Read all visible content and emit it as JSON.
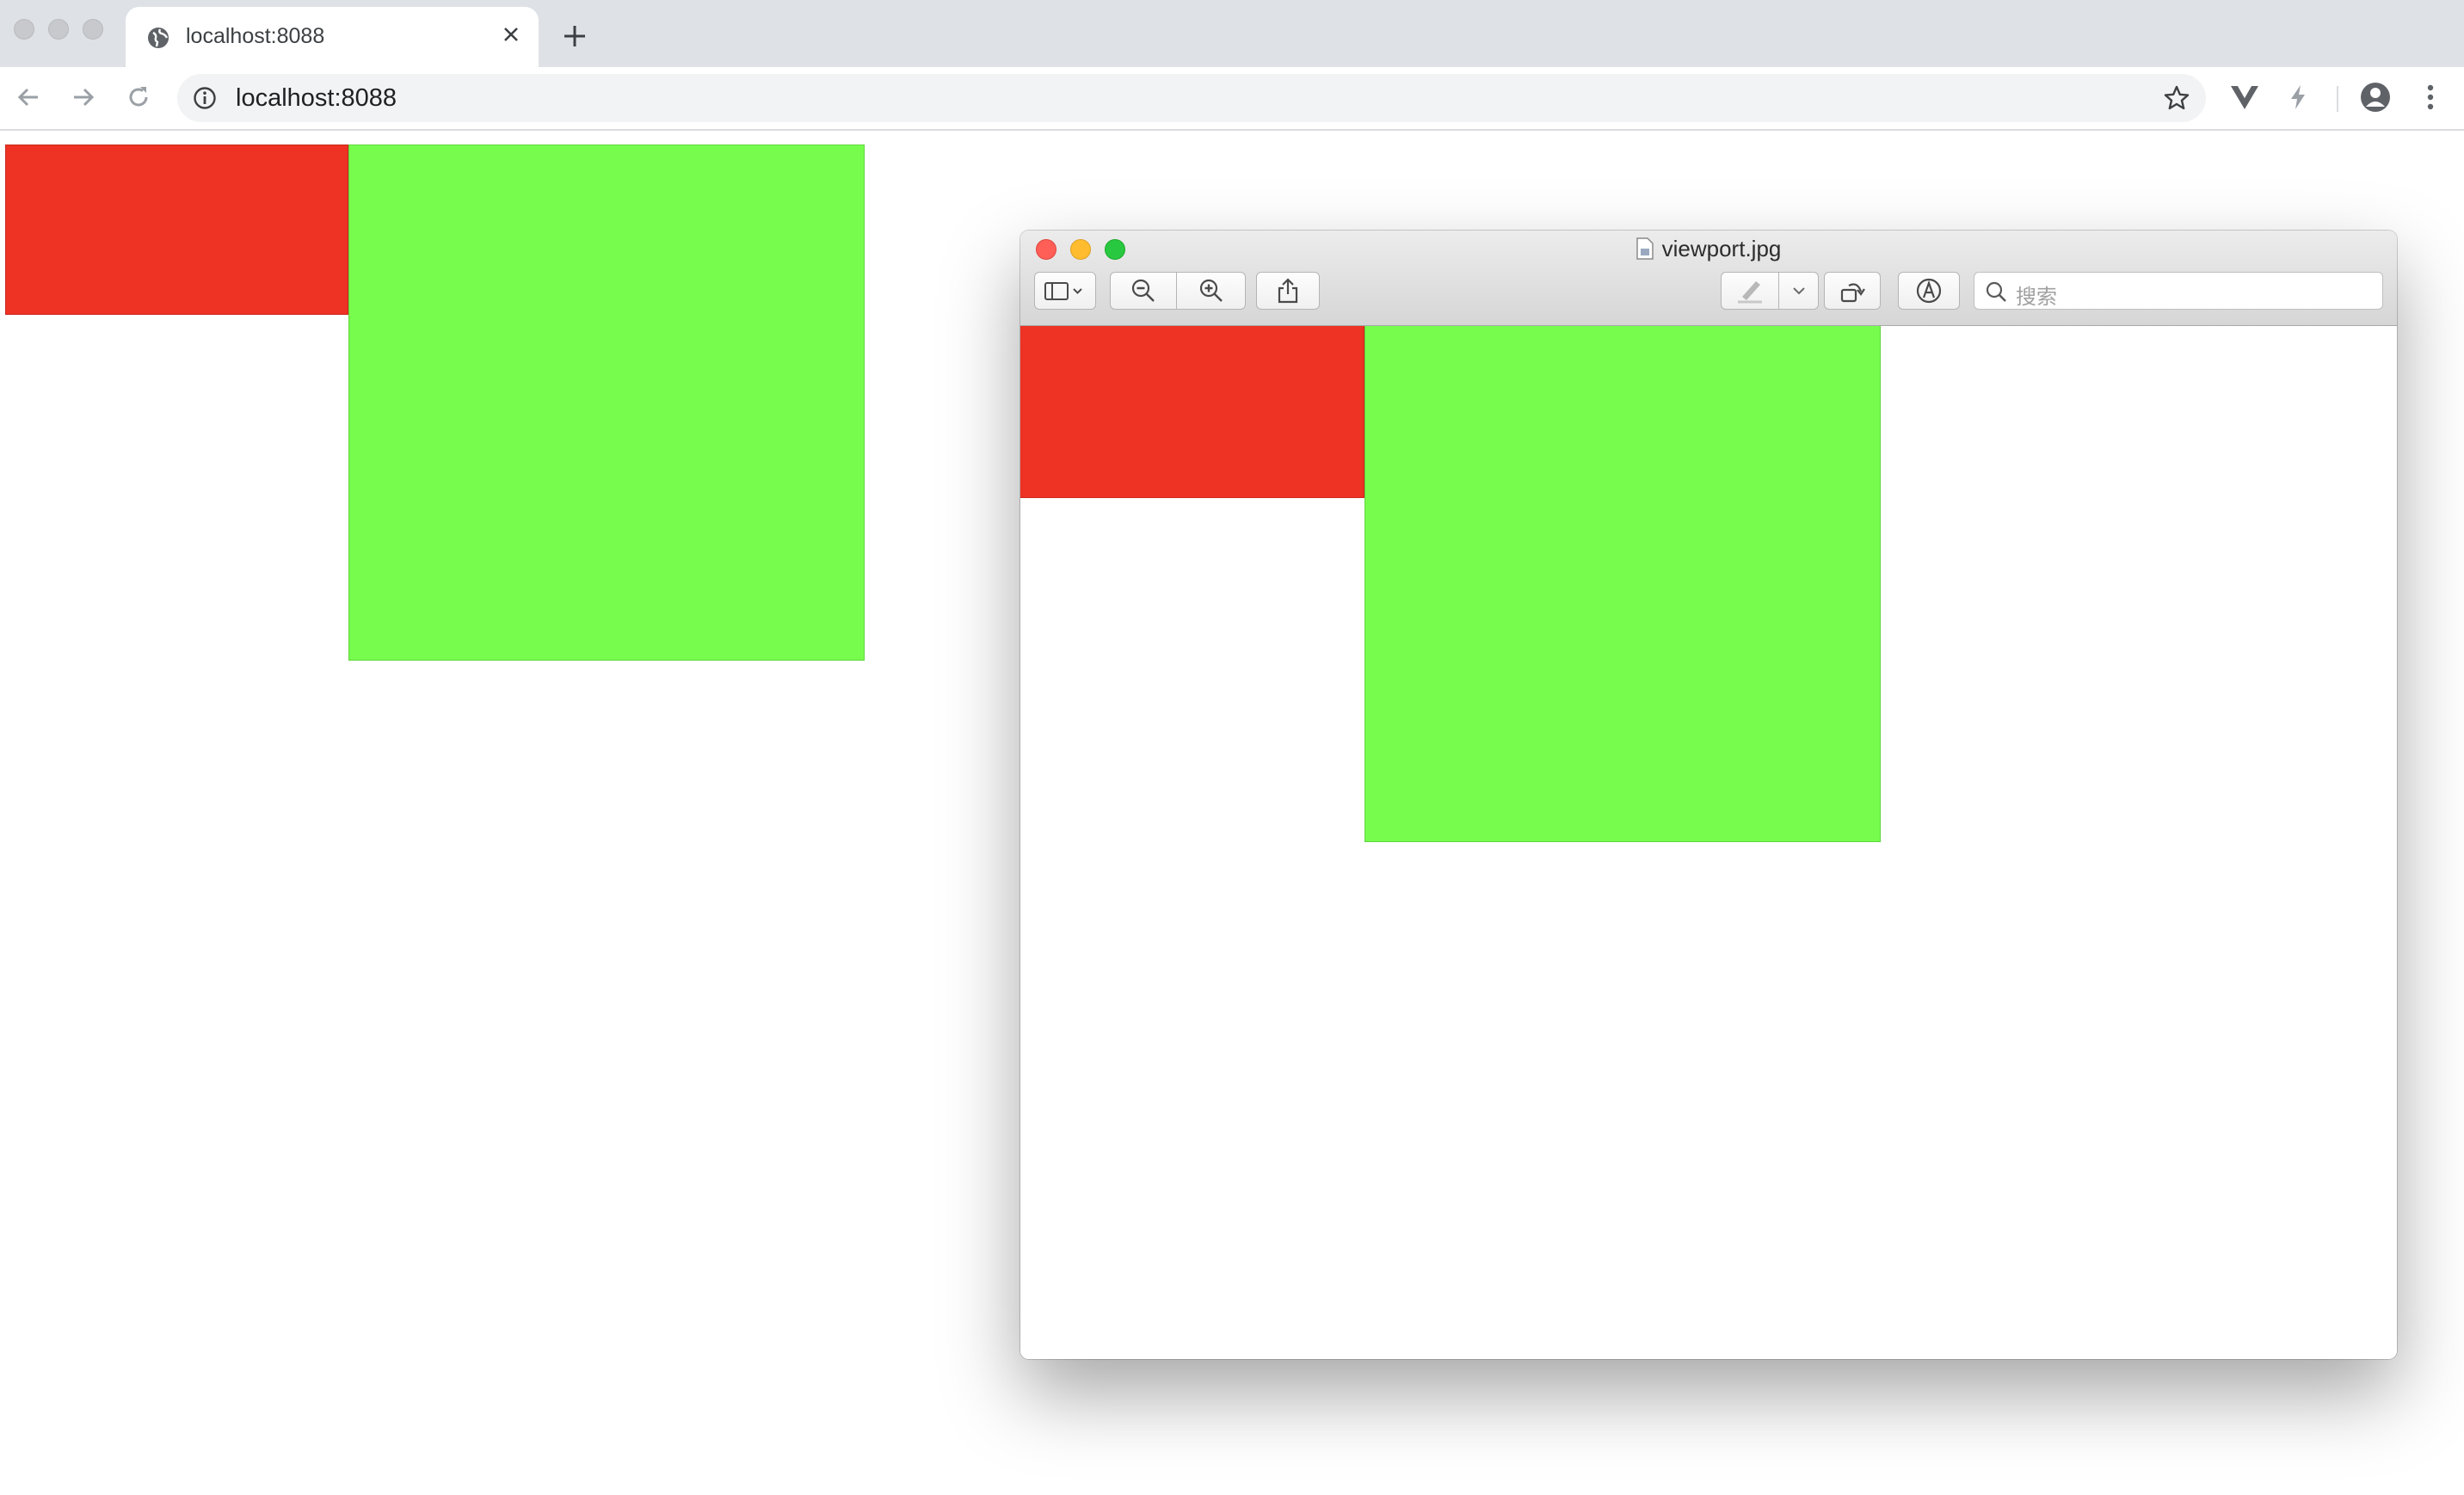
{
  "browser": {
    "tab_title": "localhost:8088",
    "new_tab_label": "+",
    "address": "localhost:8088"
  },
  "page": {
    "red_block": {
      "color": "#ee3224"
    },
    "green_block": {
      "color": "#77fc4e"
    }
  },
  "preview_window": {
    "title": "viewport.jpg",
    "search_placeholder": "搜索",
    "image": {
      "red_block": {
        "color": "#ee3224"
      },
      "green_block": {
        "color": "#77fc4e"
      }
    }
  },
  "colors": {
    "close_light": "#ff5f57",
    "minimize_light": "#febc2e",
    "zoom_light": "#28c840"
  }
}
